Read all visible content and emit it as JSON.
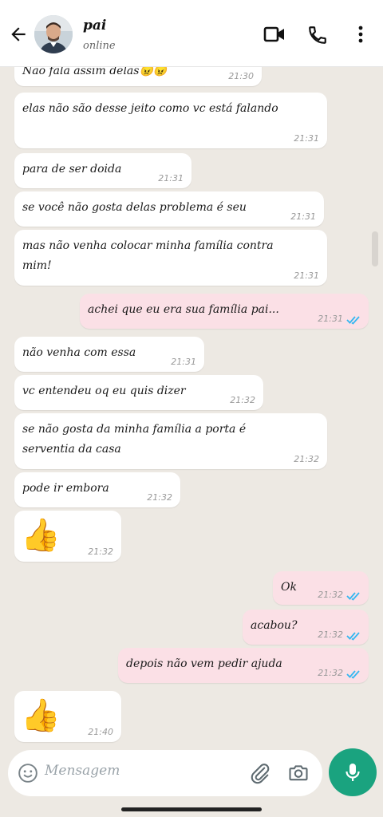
{
  "header": {
    "contact_name": "pai",
    "contact_status": "online"
  },
  "messages": [
    {
      "dir": "in",
      "text": "Não fala assim delas😠😠",
      "time": "21:30"
    },
    {
      "dir": "in",
      "text": "elas não são desse jeito como vc está falando",
      "time": "21:31"
    },
    {
      "dir": "in",
      "text": "para de ser doida",
      "time": "21:31"
    },
    {
      "dir": "in",
      "text": "se você não gosta delas problema é seu",
      "time": "21:31"
    },
    {
      "dir": "in",
      "text": "mas não venha colocar minha família contra mim!",
      "time": "21:31"
    },
    {
      "dir": "out",
      "text": "achei que eu era sua família pai...",
      "time": "21:31"
    },
    {
      "dir": "in",
      "text": "não venha com essa",
      "time": "21:31"
    },
    {
      "dir": "in",
      "text": "vc entendeu oq eu quis dizer",
      "time": "21:32"
    },
    {
      "dir": "in",
      "text": "se não gosta da minha família a porta é serventia da casa",
      "time": "21:32"
    },
    {
      "dir": "in",
      "text": "pode ir embora",
      "time": "21:32"
    },
    {
      "dir": "in",
      "text": "👍",
      "time": "21:32"
    },
    {
      "dir": "out",
      "text": "Ok",
      "time": "21:32"
    },
    {
      "dir": "out",
      "text": "acabou?",
      "time": "21:32"
    },
    {
      "dir": "out",
      "text": "depois não vem pedir ajuda",
      "time": "21:32"
    },
    {
      "dir": "in",
      "text": "👍",
      "time": "21:40"
    }
  ],
  "composer": {
    "placeholder": "Mensagem"
  },
  "icons": {
    "back": "arrow-left-icon",
    "video": "video-camera-icon",
    "call": "phone-icon",
    "menu": "kebab-menu-icon",
    "emoji": "emoji-icon",
    "attach": "paperclip-icon",
    "camera": "camera-icon",
    "mic": "microphone-icon",
    "read": "double-check-icon"
  },
  "colors": {
    "incoming_bubble": "#ffffff",
    "outgoing_bubble": "#fbe0e6",
    "read_tick": "#34b7f1",
    "mic_button": "#1aa37f",
    "chat_background": "#ede9e3"
  }
}
